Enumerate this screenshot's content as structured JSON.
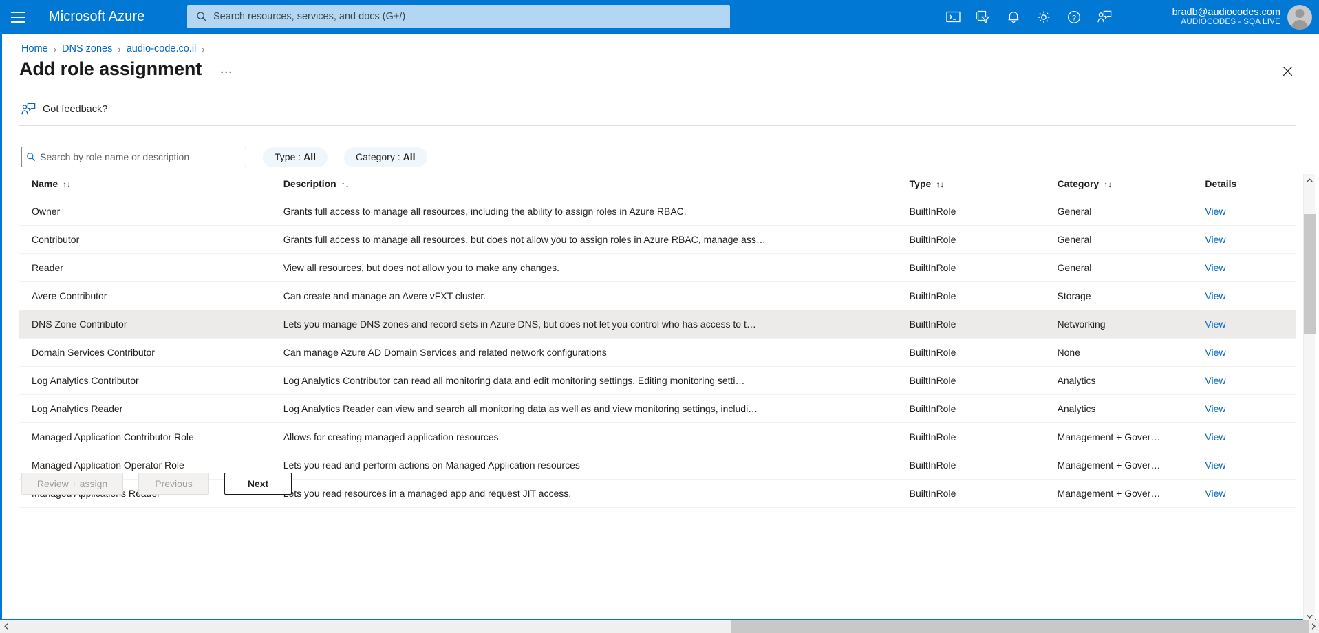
{
  "header": {
    "menu_icon": "hamburger-icon",
    "brand": "Microsoft Azure",
    "search_placeholder": "Search resources, services, and docs (G+/)",
    "search_value": "",
    "search_icon": "search-icon",
    "icons": [
      {
        "name": "cloud-shell-icon",
        "label": "Cloud Shell"
      },
      {
        "name": "directories-subscriptions-icon",
        "label": "Directories + subscriptions"
      },
      {
        "name": "notifications-bell-icon",
        "label": "Notifications"
      },
      {
        "name": "settings-gear-icon",
        "label": "Settings"
      },
      {
        "name": "help-question-icon",
        "label": "Help"
      },
      {
        "name": "feedback-icon",
        "label": "Feedback"
      }
    ],
    "account": {
      "email": "bradb@audiocodes.com",
      "tenant": "AUDIOCODES - SQA LIVE",
      "avatar": "user-avatar"
    },
    "brand_color": "#0078d4"
  },
  "breadcrumb": {
    "items": [
      "Home",
      "DNS zones",
      "audio-code.co.il"
    ],
    "separator": "›"
  },
  "blade": {
    "title": "Add role assignment",
    "more_label": "…",
    "close_label": "✕",
    "feedback_label": "Got feedback?",
    "feedback_icon": "feedback-person-icon"
  },
  "filters": {
    "search_placeholder": "Search by role name or description",
    "search_value": "",
    "search_icon": "search-icon",
    "pills": [
      {
        "label": "Type :",
        "value": "All",
        "name": "filter-type"
      },
      {
        "label": "Category :",
        "value": "All",
        "name": "filter-category"
      }
    ]
  },
  "table": {
    "sort_glyph": "↑↓",
    "columns": [
      {
        "key": "name",
        "label": "Name",
        "sortable": true
      },
      {
        "key": "description",
        "label": "Description",
        "sortable": true
      },
      {
        "key": "type",
        "label": "Type",
        "sortable": true
      },
      {
        "key": "category",
        "label": "Category",
        "sortable": true
      },
      {
        "key": "details",
        "label": "Details",
        "sortable": false
      }
    ],
    "view_label": "View",
    "selected_index": 4,
    "rows": [
      {
        "name": "Owner",
        "description": "Grants full access to manage all resources, including the ability to assign roles in Azure RBAC.",
        "type": "BuiltInRole",
        "category": "General",
        "details": "View"
      },
      {
        "name": "Contributor",
        "description": "Grants full access to manage all resources, but does not allow you to assign roles in Azure RBAC, manage ass…",
        "type": "BuiltInRole",
        "category": "General",
        "details": "View"
      },
      {
        "name": "Reader",
        "description": "View all resources, but does not allow you to make any changes.",
        "type": "BuiltInRole",
        "category": "General",
        "details": "View"
      },
      {
        "name": "Avere Contributor",
        "description": "Can create and manage an Avere vFXT cluster.",
        "type": "BuiltInRole",
        "category": "Storage",
        "details": "View"
      },
      {
        "name": "DNS Zone Contributor",
        "description": "Lets you manage DNS zones and record sets in Azure DNS, but does not let you control who has access to t…",
        "type": "BuiltInRole",
        "category": "Networking",
        "details": "View"
      },
      {
        "name": "Domain Services Contributor",
        "description": "Can manage Azure AD Domain Services and related network configurations",
        "type": "BuiltInRole",
        "category": "None",
        "details": "View"
      },
      {
        "name": "Log Analytics Contributor",
        "description": "Log Analytics Contributor can read all monitoring data and edit monitoring settings. Editing monitoring setti…",
        "type": "BuiltInRole",
        "category": "Analytics",
        "details": "View"
      },
      {
        "name": "Log Analytics Reader",
        "description": "Log Analytics Reader can view and search all monitoring data as well as and view monitoring settings, includi…",
        "type": "BuiltInRole",
        "category": "Analytics",
        "details": "View"
      },
      {
        "name": "Managed Application Contributor Role",
        "description": "Allows for creating managed application resources.",
        "type": "BuiltInRole",
        "category": "Management + Gover…",
        "details": "View"
      },
      {
        "name": "Managed Application Operator Role",
        "description": "Lets you read and perform actions on Managed Application resources",
        "type": "BuiltInRole",
        "category": "Management + Gover…",
        "details": "View"
      },
      {
        "name": "Managed Applications Reader",
        "description": "Lets you read resources in a managed app and request JIT access.",
        "type": "BuiltInRole",
        "category": "Management + Gover…",
        "details": "View"
      }
    ]
  },
  "footer": {
    "review_assign": "Review + assign",
    "previous": "Previous",
    "next": "Next"
  },
  "colors": {
    "accent": "#0078d4",
    "link": "#0066bf",
    "selection_outline": "#d13438",
    "selected_row_bg": "#edebe9"
  }
}
